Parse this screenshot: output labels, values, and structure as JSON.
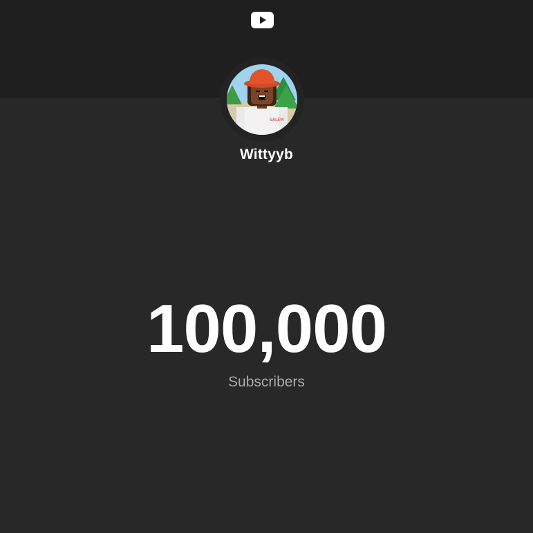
{
  "header": {
    "logo_icon": "youtube-play-icon",
    "banner_color": "#1f1f1f"
  },
  "channel": {
    "name": "Wittyyb",
    "avatar_icon": "roblox-avatar"
  },
  "counter": {
    "value": "100,000",
    "label": "Subscribers"
  },
  "colors": {
    "background": "#282828",
    "primary_text": "#ffffff",
    "secondary_text": "#aaaaaa"
  }
}
